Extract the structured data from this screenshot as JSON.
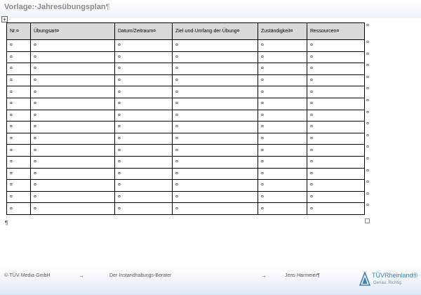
{
  "document": {
    "title": "Vorlage:·Jahresübungsplan",
    "title_pilcrow": "¶",
    "end_pilcrow": "¶"
  },
  "table": {
    "headers": [
      "Nr.¤",
      "Übungsart¤",
      "Datum/Zeitraum¤",
      "Ziel·und·Umfang·der·Übung¤",
      "Zuständigkeit¤",
      "Ressourcen¤"
    ],
    "cell_mark": "¤",
    "row_end_mark": "¤",
    "rows": [
      [
        "¤",
        "¤",
        "¤",
        "¤",
        "¤",
        "¤"
      ],
      [
        "¤",
        "¤",
        "¤",
        "¤",
        "¤",
        "¤"
      ],
      [
        "¤",
        "¤",
        "¤",
        "¤",
        "¤",
        "¤"
      ],
      [
        "¤",
        "¤",
        "¤",
        "¤",
        "¤",
        "¤"
      ],
      [
        "¤",
        "¤",
        "¤",
        "¤",
        "¤",
        "¤"
      ],
      [
        "¤",
        "¤",
        "¤",
        "¤",
        "¤",
        "¤"
      ],
      [
        "¤",
        "¤",
        "¤",
        "¤",
        "¤",
        "¤"
      ],
      [
        "¤",
        "¤",
        "¤",
        "¤",
        "¤",
        "¤"
      ],
      [
        "¤",
        "¤",
        "¤",
        "¤",
        "¤",
        "¤"
      ],
      [
        "¤",
        "¤",
        "¤",
        "¤",
        "¤",
        "¤"
      ],
      [
        "¤",
        "¤",
        "¤",
        "¤",
        "¤",
        "¤"
      ],
      [
        "¤",
        "¤",
        "¤",
        "¤",
        "¤",
        "¤"
      ],
      [
        "¤",
        "¤",
        "¤",
        "¤",
        "¤",
        "¤"
      ],
      [
        "¤",
        "¤",
        "¤",
        "¤",
        "¤",
        "¤"
      ],
      [
        "¤",
        "¤",
        "¤",
        "¤",
        "¤",
        "¤"
      ]
    ]
  },
  "footer": {
    "left": "©·TÜV·Media·GmbH",
    "arrow": "→",
    "center": "Der·Instandhaltungs-Berater",
    "right": "Jens·Harmeier¶",
    "logo_name": "TÜVRheinland®",
    "logo_tagline": "Genau. Richtig."
  },
  "colors": {
    "header_fill": "#d9d9d9",
    "logo_blue": "#3d7fb8"
  },
  "icons": {
    "table_move": "table-move-handle-icon",
    "table_resize": "table-resize-handle-icon",
    "logo": "tuv-triangle-logo-icon"
  }
}
